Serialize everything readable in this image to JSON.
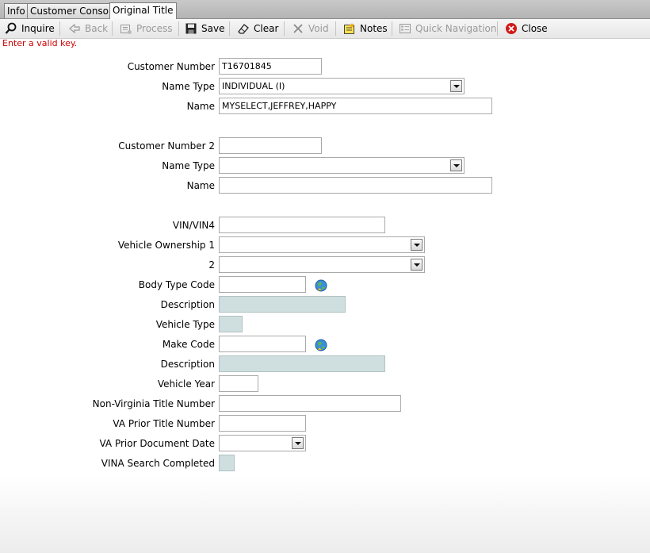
{
  "tabs": [
    "Info",
    "Customer Console",
    "Original Title"
  ],
  "toolbar": {
    "inquire": "Inquire",
    "back": "Back",
    "process": "Process",
    "save": "Save",
    "clear": "Clear",
    "void": "Void",
    "notes": "Notes",
    "quick_navigation": "Quick Navigation",
    "close": "Close"
  },
  "error_message": "Enter a valid key.",
  "form": {
    "customer_number": {
      "label": "Customer Number",
      "value": "T16701845"
    },
    "name_type": {
      "label": "Name Type",
      "value": "INDIVIDUAL (I)"
    },
    "name": {
      "label": "Name",
      "value": "MYSELECT,JEFFREY,HAPPY"
    },
    "customer_number_2": {
      "label": "Customer Number 2",
      "value": ""
    },
    "name_type_2": {
      "label": "Name Type",
      "value": ""
    },
    "name_2": {
      "label": "Name",
      "value": ""
    },
    "vin": {
      "label": "VIN/VIN4",
      "value": ""
    },
    "vehicle_ownership_1": {
      "label": "Vehicle Ownership 1",
      "value": ""
    },
    "vehicle_ownership_2": {
      "label": "2",
      "value": ""
    },
    "body_type_code": {
      "label": "Body Type Code",
      "value": ""
    },
    "body_description": {
      "label": "Description",
      "value": ""
    },
    "vehicle_type": {
      "label": "Vehicle Type",
      "value": ""
    },
    "make_code": {
      "label": "Make Code",
      "value": ""
    },
    "make_description": {
      "label": "Description",
      "value": ""
    },
    "vehicle_year": {
      "label": "Vehicle Year",
      "value": ""
    },
    "non_va_title_number": {
      "label": "Non-Virginia Title Number",
      "value": ""
    },
    "va_prior_title_number": {
      "label": "VA Prior Title Number",
      "value": ""
    },
    "va_prior_document_date": {
      "label": "VA Prior Document Date",
      "value": ""
    },
    "vina_search_completed": {
      "label": "VINA Search Completed",
      "value": ""
    }
  },
  "colors": {
    "error": "#cc0000",
    "readonly_field": "#cfdedf"
  }
}
